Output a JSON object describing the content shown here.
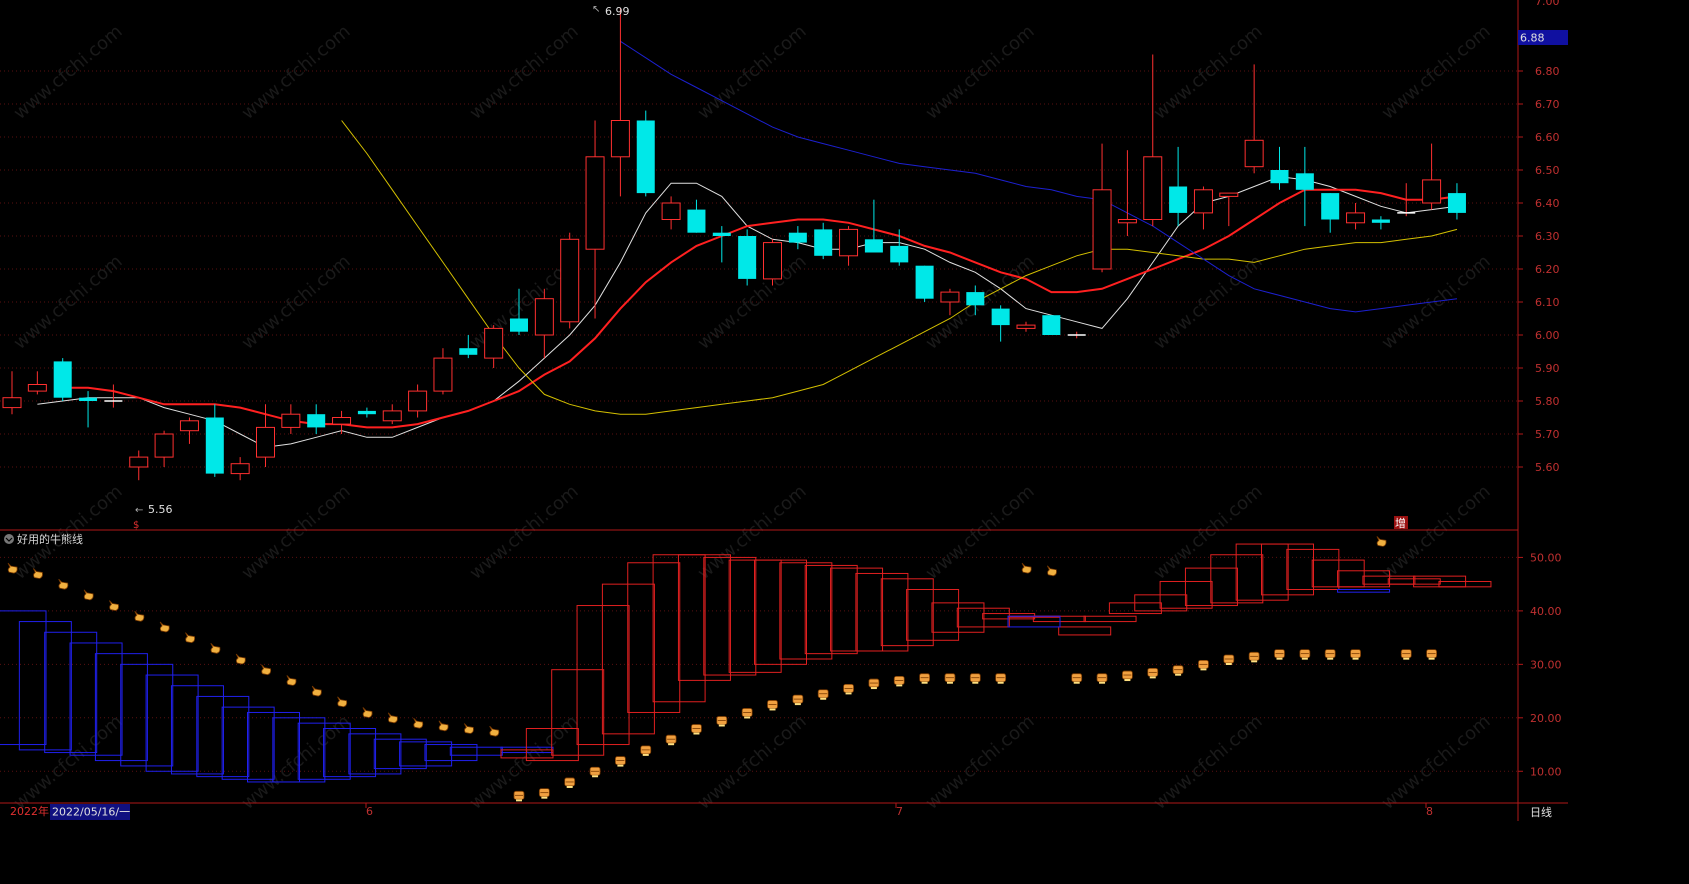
{
  "chart_data": [
    {
      "type": "candlestick",
      "price_axis": {
        "min": 5.5,
        "max": 7.0,
        "ticks": [
          "5.60",
          "5.70",
          "5.80",
          "5.90",
          "6.00",
          "6.10",
          "6.20",
          "6.30",
          "6.40",
          "6.50",
          "6.60",
          "6.70",
          "6.80"
        ],
        "top_tick_partial": "7.00"
      },
      "current_price_tag": "6.88",
      "high_label": "6.99",
      "low_label": "5.56",
      "markers": [
        "$",
        "增"
      ],
      "x_labels": {
        "year": "2022年",
        "date": "2022/05/16/一",
        "months": [
          "6",
          "7",
          "8"
        ]
      },
      "period": "日线",
      "candles": [
        {
          "o": 5.78,
          "h": 5.89,
          "l": 5.76,
          "c": 5.81
        },
        {
          "o": 5.83,
          "h": 5.89,
          "l": 5.82,
          "c": 5.85
        },
        {
          "o": 5.92,
          "h": 5.93,
          "l": 5.8,
          "c": 5.81
        },
        {
          "o": 5.81,
          "h": 5.83,
          "l": 5.72,
          "c": 5.8
        },
        {
          "o": 5.8,
          "h": 5.85,
          "l": 5.78,
          "c": 5.8
        },
        {
          "o": 5.6,
          "h": 5.65,
          "l": 5.56,
          "c": 5.63
        },
        {
          "o": 5.63,
          "h": 5.71,
          "l": 5.6,
          "c": 5.7
        },
        {
          "o": 5.71,
          "h": 5.75,
          "l": 5.67,
          "c": 5.74
        },
        {
          "o": 5.75,
          "h": 5.79,
          "l": 5.57,
          "c": 5.58
        },
        {
          "o": 5.58,
          "h": 5.63,
          "l": 5.56,
          "c": 5.61
        },
        {
          "o": 5.63,
          "h": 5.79,
          "l": 5.6,
          "c": 5.72
        },
        {
          "o": 5.72,
          "h": 5.79,
          "l": 5.7,
          "c": 5.76
        },
        {
          "o": 5.76,
          "h": 5.79,
          "l": 5.7,
          "c": 5.72
        },
        {
          "o": 5.73,
          "h": 5.77,
          "l": 5.7,
          "c": 5.75
        },
        {
          "o": 5.77,
          "h": 5.78,
          "l": 5.75,
          "c": 5.76
        },
        {
          "o": 5.74,
          "h": 5.79,
          "l": 5.73,
          "c": 5.77
        },
        {
          "o": 5.77,
          "h": 5.85,
          "l": 5.75,
          "c": 5.83
        },
        {
          "o": 5.83,
          "h": 5.96,
          "l": 5.82,
          "c": 5.93
        },
        {
          "o": 5.96,
          "h": 6.0,
          "l": 5.93,
          "c": 5.94
        },
        {
          "o": 5.93,
          "h": 6.03,
          "l": 5.9,
          "c": 6.02
        },
        {
          "o": 6.05,
          "h": 6.14,
          "l": 6.0,
          "c": 6.01
        },
        {
          "o": 6.0,
          "h": 6.14,
          "l": 5.93,
          "c": 6.11
        },
        {
          "o": 6.04,
          "h": 6.31,
          "l": 6.02,
          "c": 6.29
        },
        {
          "o": 6.26,
          "h": 6.65,
          "l": 6.05,
          "c": 6.54
        },
        {
          "o": 6.54,
          "h": 6.99,
          "l": 6.42,
          "c": 6.65
        },
        {
          "o": 6.65,
          "h": 6.68,
          "l": 6.42,
          "c": 6.43
        },
        {
          "o": 6.35,
          "h": 6.42,
          "l": 6.32,
          "c": 6.4
        },
        {
          "o": 6.38,
          "h": 6.41,
          "l": 6.31,
          "c": 6.31
        },
        {
          "o": 6.31,
          "h": 6.33,
          "l": 6.22,
          "c": 6.3
        },
        {
          "o": 6.3,
          "h": 6.32,
          "l": 6.15,
          "c": 6.17
        },
        {
          "o": 6.17,
          "h": 6.29,
          "l": 6.15,
          "c": 6.28
        },
        {
          "o": 6.31,
          "h": 6.33,
          "l": 6.26,
          "c": 6.28
        },
        {
          "o": 6.32,
          "h": 6.34,
          "l": 6.23,
          "c": 6.24
        },
        {
          "o": 6.24,
          "h": 6.33,
          "l": 6.21,
          "c": 6.32
        },
        {
          "o": 6.29,
          "h": 6.41,
          "l": 6.25,
          "c": 6.25
        },
        {
          "o": 6.27,
          "h": 6.32,
          "l": 6.21,
          "c": 6.22
        },
        {
          "o": 6.21,
          "h": 6.21,
          "l": 6.1,
          "c": 6.11
        },
        {
          "o": 6.1,
          "h": 6.14,
          "l": 6.06,
          "c": 6.13
        },
        {
          "o": 6.13,
          "h": 6.15,
          "l": 6.06,
          "c": 6.09
        },
        {
          "o": 6.08,
          "h": 6.09,
          "l": 5.98,
          "c": 6.03
        },
        {
          "o": 6.02,
          "h": 6.04,
          "l": 6.01,
          "c": 6.03
        },
        {
          "o": 6.06,
          "h": 6.06,
          "l": 6.0,
          "c": 6.0
        },
        {
          "o": 6.0,
          "h": 6.01,
          "l": 5.99,
          "c": 6.0
        },
        {
          "o": 6.2,
          "h": 6.58,
          "l": 6.19,
          "c": 6.44
        },
        {
          "o": 6.34,
          "h": 6.56,
          "l": 6.3,
          "c": 6.35
        },
        {
          "o": 6.35,
          "h": 6.85,
          "l": 6.33,
          "c": 6.54
        },
        {
          "o": 6.45,
          "h": 6.57,
          "l": 6.33,
          "c": 6.37
        },
        {
          "o": 6.37,
          "h": 6.45,
          "l": 6.32,
          "c": 6.44
        },
        {
          "o": 6.42,
          "h": 6.43,
          "l": 6.33,
          "c": 6.43
        },
        {
          "o": 6.51,
          "h": 6.82,
          "l": 6.49,
          "c": 6.59
        },
        {
          "o": 6.5,
          "h": 6.57,
          "l": 6.44,
          "c": 6.46
        },
        {
          "o": 6.49,
          "h": 6.57,
          "l": 6.33,
          "c": 6.44
        },
        {
          "o": 6.43,
          "h": 6.43,
          "l": 6.31,
          "c": 6.35
        },
        {
          "o": 6.34,
          "h": 6.4,
          "l": 6.32,
          "c": 6.37
        },
        {
          "o": 6.35,
          "h": 6.36,
          "l": 6.32,
          "c": 6.34
        },
        {
          "o": 6.37,
          "h": 6.46,
          "l": 6.36,
          "c": 6.37
        },
        {
          "o": 6.4,
          "h": 6.58,
          "l": 6.38,
          "c": 6.47
        },
        {
          "o": 6.43,
          "h": 6.46,
          "l": 6.35,
          "c": 6.37
        }
      ],
      "moving_averages": [
        {
          "color": "#e0e0e0",
          "width": 1,
          "values": [
            5.79,
            5.8,
            5.81,
            5.81,
            5.81,
            5.78,
            5.76,
            5.74,
            5.7,
            5.66,
            5.67,
            5.69,
            5.71,
            5.69,
            5.69,
            5.72,
            5.75,
            5.77,
            5.8,
            5.86,
            5.93,
            6.0,
            6.09,
            6.22,
            6.37,
            6.46,
            6.46,
            6.42,
            6.33,
            6.29,
            6.28,
            6.26,
            6.26,
            6.28,
            6.28,
            6.26,
            6.22,
            6.19,
            6.14,
            6.08,
            6.06,
            6.04,
            6.02,
            6.11,
            6.22,
            6.33,
            6.4,
            6.42,
            6.45,
            6.48,
            6.47,
            6.45,
            6.42,
            6.39,
            6.37,
            6.38,
            6.39
          ]
        },
        {
          "color": "#ff2020",
          "width": 2,
          "values": [
            5.84,
            5.84,
            5.83,
            5.81,
            5.79,
            5.79,
            5.79,
            5.78,
            5.76,
            5.74,
            5.73,
            5.73,
            5.72,
            5.72,
            5.73,
            5.75,
            5.77,
            5.8,
            5.83,
            5.88,
            5.92,
            5.99,
            6.08,
            6.16,
            6.22,
            6.27,
            6.3,
            6.33,
            6.34,
            6.35,
            6.35,
            6.34,
            6.32,
            6.3,
            6.27,
            6.25,
            6.22,
            6.19,
            6.17,
            6.13,
            6.13,
            6.14,
            6.17,
            6.2,
            6.23,
            6.26,
            6.3,
            6.35,
            6.4,
            6.44,
            6.44,
            6.44,
            6.43,
            6.41,
            6.41,
            6.42
          ]
        },
        {
          "color": "#d4c000",
          "width": 1,
          "values": [
            6.65,
            6.55,
            6.44,
            6.33,
            6.22,
            6.11,
            6.0,
            5.9,
            5.82,
            5.79,
            5.77,
            5.76,
            5.76,
            5.77,
            5.78,
            5.79,
            5.8,
            5.81,
            5.83,
            5.85,
            5.89,
            5.93,
            5.97,
            6.01,
            6.05,
            6.1,
            6.14,
            6.18,
            6.21,
            6.24,
            6.26,
            6.26,
            6.25,
            6.24,
            6.23,
            6.23,
            6.22,
            6.24,
            6.26,
            6.27,
            6.28,
            6.28,
            6.29,
            6.3,
            6.32
          ]
        },
        {
          "color": "#1c20d0",
          "width": 1,
          "values": [
            6.89,
            6.84,
            6.79,
            6.75,
            6.71,
            6.67,
            6.63,
            6.6,
            6.58,
            6.56,
            6.54,
            6.52,
            6.51,
            6.5,
            6.49,
            6.47,
            6.45,
            6.44,
            6.42,
            6.41,
            6.37,
            6.33,
            6.28,
            6.23,
            6.18,
            6.14,
            6.12,
            6.1,
            6.08,
            6.07,
            6.08,
            6.09,
            6.1,
            6.11
          ]
        }
      ]
    },
    {
      "type": "indicator",
      "title": "好用的牛熊线",
      "y_axis": {
        "min": 5,
        "max": 57,
        "ticks": [
          "10.00",
          "20.00",
          "30.00",
          "40.00",
          "50.00"
        ]
      },
      "boxes_blue": [
        [
          40,
          15
        ],
        [
          38,
          14
        ],
        [
          36,
          13.5
        ],
        [
          34,
          13
        ],
        [
          32,
          12
        ],
        [
          30,
          11
        ],
        [
          28,
          10
        ],
        [
          26,
          9.5
        ],
        [
          24,
          9
        ],
        [
          22,
          8.5
        ],
        [
          21,
          8
        ],
        [
          20,
          8
        ],
        [
          19,
          8.5
        ],
        [
          18,
          9
        ],
        [
          17,
          9.5
        ],
        [
          16,
          10.5
        ],
        [
          15.5,
          11
        ],
        [
          15,
          12
        ],
        [
          14.5,
          13
        ],
        [
          14,
          14
        ],
        [
          13.5,
          14.5
        ]
      ],
      "boxes_red": [
        [
          14,
          12.5
        ],
        [
          18,
          12
        ],
        [
          29,
          13
        ],
        [
          41,
          15
        ],
        [
          45,
          17
        ],
        [
          49,
          21
        ],
        [
          50.5,
          23
        ],
        [
          50.5,
          27
        ],
        [
          50,
          28
        ],
        [
          49.5,
          28.5
        ],
        [
          49.5,
          30
        ],
        [
          49,
          31
        ],
        [
          48.5,
          32
        ],
        [
          48,
          32.5
        ],
        [
          47,
          32.5
        ],
        [
          46,
          33.5
        ],
        [
          44,
          34.5
        ],
        [
          41.5,
          36
        ],
        [
          40.5,
          37
        ],
        [
          39.5,
          38.5
        ],
        [
          39,
          39
        ],
        [
          38,
          39
        ],
        [
          35.5,
          37
        ],
        [
          38,
          39
        ],
        [
          41.5,
          39.5
        ],
        [
          43,
          40
        ],
        [
          45.5,
          40.5
        ],
        [
          48,
          41
        ],
        [
          50.5,
          41.5
        ],
        [
          52.5,
          42
        ],
        [
          52.5,
          43
        ],
        [
          51.5,
          44
        ],
        [
          49.5,
          44.5
        ],
        [
          47.5,
          44.5
        ],
        [
          46.5,
          45
        ],
        [
          46,
          45
        ],
        [
          46.5,
          44.5
        ],
        [
          45.5,
          44.5
        ]
      ],
      "boxes_blue_late": [
        [
          39,
          37
        ],
        [
          44,
          43.5
        ]
      ],
      "hand_icons": [
        [
          0,
          48
        ],
        [
          1,
          47
        ],
        [
          2,
          45
        ],
        [
          3,
          43
        ],
        [
          4,
          41
        ],
        [
          5,
          39
        ],
        [
          6,
          37
        ],
        [
          7,
          35
        ],
        [
          8,
          33
        ],
        [
          9,
          31
        ],
        [
          10,
          29
        ],
        [
          11,
          27
        ],
        [
          12,
          25
        ],
        [
          13,
          23
        ],
        [
          14,
          21
        ],
        [
          15,
          20
        ],
        [
          16,
          19
        ],
        [
          17,
          18.5
        ],
        [
          18,
          18
        ],
        [
          19,
          17.5
        ],
        [
          40,
          48
        ],
        [
          41,
          47.5
        ],
        [
          54,
          53
        ]
      ],
      "coin_icons": [
        [
          20,
          5.5
        ],
        [
          21,
          6
        ],
        [
          22,
          8
        ],
        [
          23,
          10
        ],
        [
          24,
          12
        ],
        [
          25,
          14
        ],
        [
          26,
          16
        ],
        [
          27,
          18
        ],
        [
          28,
          19.5
        ],
        [
          29,
          21
        ],
        [
          30,
          22.5
        ],
        [
          31,
          23.5
        ],
        [
          32,
          24.5
        ],
        [
          33,
          25.5
        ],
        [
          34,
          26.5
        ],
        [
          35,
          27
        ],
        [
          36,
          27.5
        ],
        [
          37,
          27.5
        ],
        [
          38,
          27.5
        ],
        [
          39,
          27.5
        ],
        [
          42,
          27.5
        ],
        [
          43,
          27.5
        ],
        [
          44,
          28
        ],
        [
          45,
          28.5
        ],
        [
          46,
          29
        ],
        [
          47,
          30
        ],
        [
          48,
          31
        ],
        [
          49,
          31.5
        ],
        [
          50,
          32
        ],
        [
          51,
          32
        ],
        [
          52,
          32
        ],
        [
          53,
          32
        ],
        [
          55,
          32
        ],
        [
          56,
          32
        ]
      ]
    }
  ]
}
